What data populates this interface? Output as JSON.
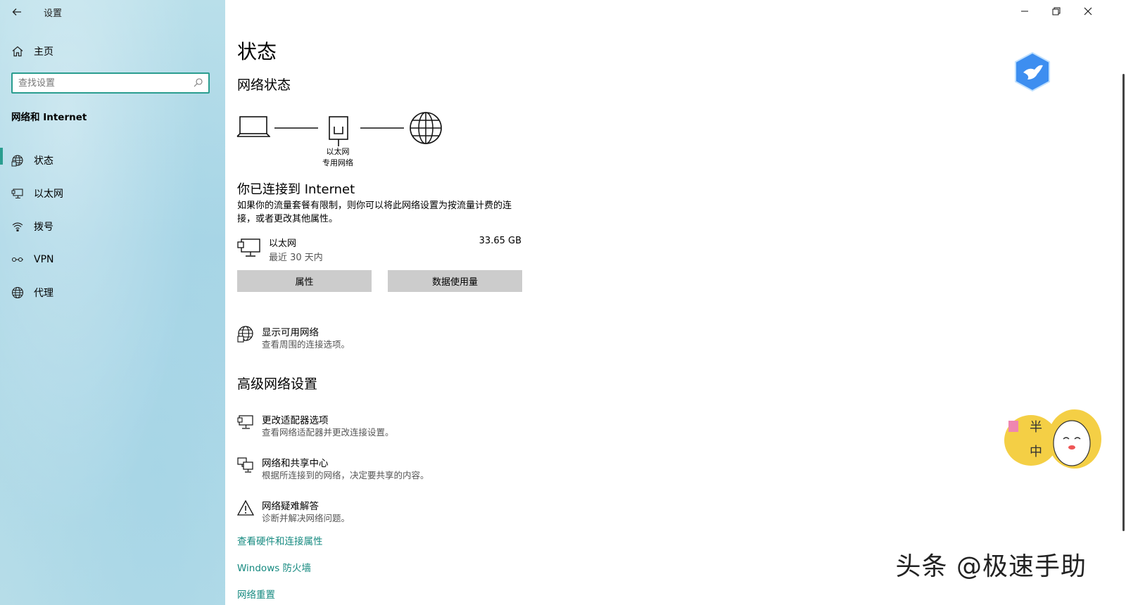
{
  "window": {
    "app_title": "设置",
    "controls": {
      "minimize_icon": "minimize-icon",
      "restore_icon": "restore-icon",
      "close_icon": "close-icon"
    }
  },
  "sidebar": {
    "home_label": "主页",
    "search_placeholder": "查找设置",
    "section_title": "网络和 Internet",
    "items": [
      {
        "label": "状态",
        "icon": "status-icon",
        "active": true
      },
      {
        "label": "以太网",
        "icon": "ethernet-icon",
        "active": false
      },
      {
        "label": "拨号",
        "icon": "dialup-icon",
        "active": false
      },
      {
        "label": "VPN",
        "icon": "vpn-icon",
        "active": false
      },
      {
        "label": "代理",
        "icon": "proxy-icon",
        "active": false
      }
    ],
    "accent_color": "#2a9d8f"
  },
  "main": {
    "page_title": "状态",
    "network_status_title": "网络状态",
    "diagram": {
      "adapter_name": "以太网",
      "network_type": "专用网络"
    },
    "connected_title": "你已连接到 Internet",
    "connected_desc": "如果你的流量套餐有限制，则你可以将此网络设置为按流量计费的连接，或者更改其他属性。",
    "ethernet": {
      "name": "以太网",
      "period": "最近 30 天内",
      "usage": "33.65 GB"
    },
    "buttons": {
      "properties": "属性",
      "data_usage": "数据使用量"
    },
    "show_networks": {
      "title": "显示可用网络",
      "desc": "查看周围的连接选项。"
    },
    "advanced_title": "高级网络设置",
    "advanced_items": [
      {
        "title": "更改适配器选项",
        "desc": "查看网络适配器并更改连接设置。",
        "icon": "adapter-icon"
      },
      {
        "title": "网络和共享中心",
        "desc": "根据所连接到的网络，决定要共享的内容。",
        "icon": "sharing-center-icon"
      },
      {
        "title": "网络疑难解答",
        "desc": "诊断并解决网络问题。",
        "icon": "warning-icon"
      }
    ],
    "links": {
      "hardware": "查看硬件和连接属性",
      "firewall": "Windows 防火墙",
      "reset": "网络重置"
    },
    "link_color": "#168a80"
  },
  "overlay": {
    "watermark": "头条 @极速手助",
    "sticker_text_1": "半",
    "sticker_text_2": "中"
  }
}
